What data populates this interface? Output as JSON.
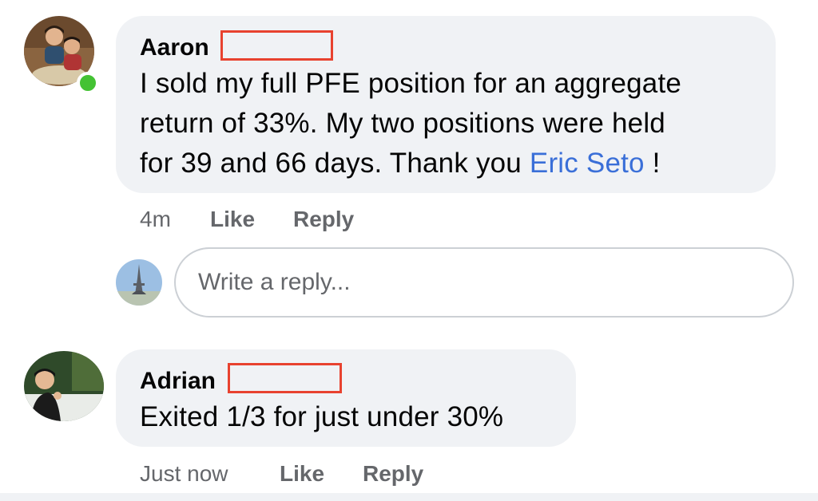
{
  "comments": [
    {
      "author": "Aaron",
      "text_lines": [
        "I sold my full PFE position for an aggregate",
        "return of 33%.  My two positions were held"
      ],
      "line3_before": "for 39 and 66 days. Thank you ",
      "mention": "Eric Seto",
      "line3_after": " !",
      "time": "4m",
      "like_label": "Like",
      "reply_label": "Reply",
      "online": true
    },
    {
      "author": "Adrian",
      "text": "Exited 1/3 for just under 30%",
      "time": "Just now",
      "like_label": "Like",
      "reply_label": "Reply"
    }
  ],
  "reply_box": {
    "placeholder": "Write a reply..."
  },
  "colors": {
    "bubble": "#f0f2f5",
    "mention": "#3a6fd8",
    "meta": "#65676b",
    "online": "#44c233",
    "redaction": "#e8422f"
  },
  "icons": {
    "aaron_avatar": "profile-photo",
    "current_user_avatar": "profile-photo",
    "adrian_avatar": "profile-photo"
  }
}
